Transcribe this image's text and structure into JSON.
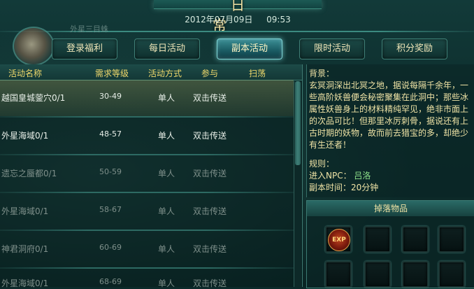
{
  "window": {
    "title": "日  常",
    "datetime": "2012年07月09日    09:53"
  },
  "player": {
    "name": "外星三目蛛"
  },
  "tabs": [
    {
      "label": "登录福利",
      "active": false
    },
    {
      "label": "每日活动",
      "active": false
    },
    {
      "label": "副本活动",
      "active": true
    },
    {
      "label": "限时活动",
      "active": false
    },
    {
      "label": "积分奖励",
      "active": false
    }
  ],
  "list": {
    "headers": [
      "活动名称",
      "需求等级",
      "活动方式",
      "参与",
      "扫荡"
    ],
    "rows": [
      {
        "name": "越国皇城蓥穴0/1",
        "level": "30-49",
        "mode": "单人",
        "join": "双击传送",
        "state": "highlight"
      },
      {
        "name": "外星海域0/1",
        "level": "48-57",
        "mode": "单人",
        "join": "双击传送",
        "state": "normal"
      },
      {
        "name": "遗忘之蜃都0/1",
        "level": "50-59",
        "mode": "单人",
        "join": "双击传送",
        "state": "dim"
      },
      {
        "name": "外星海域0/1",
        "level": "58-67",
        "mode": "单人",
        "join": "双击传送",
        "state": "dim"
      },
      {
        "name": "神君洞府0/1",
        "level": "60-69",
        "mode": "单人",
        "join": "双击传送",
        "state": "dim"
      },
      {
        "name": "外星海域0/1",
        "level": "68-69",
        "mode": "单人",
        "join": "双击传送",
        "state": "dim"
      }
    ]
  },
  "detail": {
    "background_label": "背景：",
    "background_text": "玄冥洞深出北冥之地，据说每隔千余年，一些高阶妖兽便会秘密聚集在此洞中；那些冰属性妖兽身上的材料精纯罕见，绝非市面上的次品可比！但那里冰厉刺骨，据说还有上古时期的妖物，故而前去猎宝的多，却绝少有生还者！",
    "rules_label": "规则：",
    "npc_label": "进入NPC：",
    "npc_name": "吕洛",
    "time_line": "副本时间：20分钟"
  },
  "drops": {
    "title": "掉落物品",
    "items": [
      {
        "icon": "exp-icon",
        "text": "EXP"
      }
    ]
  },
  "colors": {
    "accent": "#efd86b",
    "npc": "#8ee08a",
    "active_tab": "#3a8f95"
  }
}
